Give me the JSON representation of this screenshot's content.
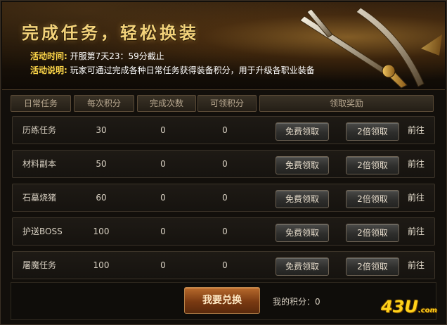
{
  "banner": {
    "title": "完成任务，轻松换装",
    "time_label": "活动时间:",
    "time_value": " 开服第7天23：59分截止",
    "desc_label": "活动说明:",
    "desc_value": " 玩家可通过完成各种日常任务获得装备积分，用于升级各职业装备"
  },
  "table": {
    "headers": [
      "日常任务",
      "每次积分",
      "完成次数",
      "可领积分",
      "领取奖励"
    ],
    "rows": [
      {
        "name": "历练任务",
        "per": "30",
        "done": "0",
        "available": "0"
      },
      {
        "name": "材料副本",
        "per": "50",
        "done": "0",
        "available": "0"
      },
      {
        "name": "石墓烧猪",
        "per": "60",
        "done": "0",
        "available": "0"
      },
      {
        "name": "护送BOSS",
        "per": "100",
        "done": "0",
        "available": "0"
      },
      {
        "name": "屠魔任务",
        "per": "100",
        "done": "0",
        "available": "0"
      }
    ],
    "free_label": "免费领取",
    "double_label": "2倍领取",
    "goto_label": "前往"
  },
  "footer": {
    "exchange_label": "我要兑换",
    "points_label": "我的积分：",
    "points_value": "0",
    "logo_text": "43U",
    "logo_suffix": ".com"
  },
  "colors": {
    "title_gold": "#f3d27a",
    "label_yellow": "#ffd84a",
    "exchange_orange": "#b86a2c"
  }
}
